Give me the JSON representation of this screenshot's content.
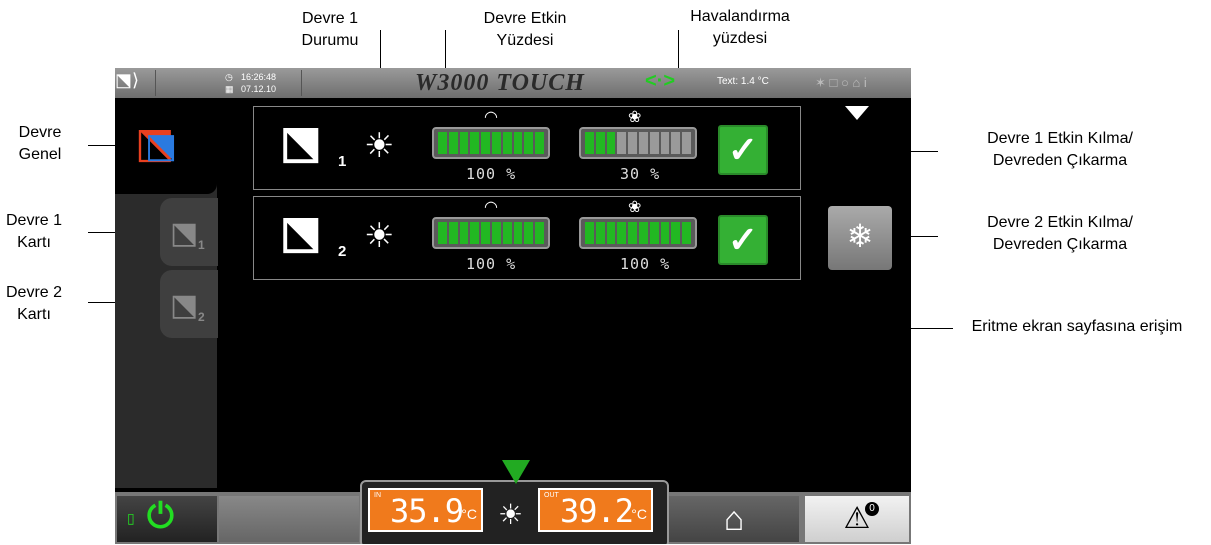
{
  "annotations": {
    "circuit1_status": "Devre 1\nDurumu",
    "circuit_active_pct": "Devre Etkin\nYüzdesi",
    "ventilation_pct": "Havalandırma\nyüzdesi",
    "circuit_general": "Devre\nGenel",
    "circuit1_card": "Devre 1\nKartı",
    "circuit2_card": "Devre 2\nKartı",
    "circuit1_enable": "Devre 1 Etkin Kılma/\nDevreden Çıkarma",
    "circuit2_enable": "Devre 2 Etkin Kılma/\nDevreden Çıkarma",
    "defrost_access": "Eritme ekran sayfasına erişim"
  },
  "topbar": {
    "time": "16:26:48",
    "date": "07.12.10",
    "brand": "W3000 TOUCH",
    "text_temp": "Text:  1.4 °C"
  },
  "sidebar": {
    "card1_num": "1",
    "card2_num": "2"
  },
  "circuits": [
    {
      "num": "1",
      "capacity_pct": "100 %",
      "capacity_fraction": 1.0,
      "fan_pct": "30 %",
      "fan_fraction": 0.3,
      "enabled": true
    },
    {
      "num": "2",
      "capacity_pct": "100 %",
      "capacity_fraction": 1.0,
      "fan_pct": "100 %",
      "fan_fraction": 1.0,
      "enabled": true
    }
  ],
  "bottom": {
    "in_label": "IN",
    "in_temp": "35.9",
    "out_label": "OUT",
    "out_temp": "39.2",
    "unit": "°C",
    "alarm_count": "0"
  },
  "colors": {
    "active_green": "#22b822",
    "temp_orange": "#f07a1c",
    "power_green": "#22dd22"
  }
}
